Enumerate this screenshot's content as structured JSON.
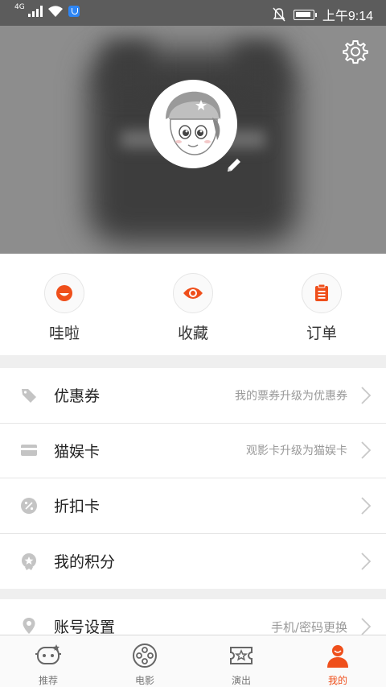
{
  "status_bar": {
    "network": "4G",
    "time": "上午9:14"
  },
  "colors": {
    "accent": "#ef4f1b",
    "header_bg": "#8d8d8d",
    "divider": "#efefef"
  },
  "header": {
    "settings_icon": "gear-icon",
    "avatar_icon": "cartoon-avatar",
    "edit_icon": "pencil-icon"
  },
  "quick_actions": [
    {
      "label": "哇啦",
      "icon": "smile-icon"
    },
    {
      "label": "收藏",
      "icon": "eye-icon"
    },
    {
      "label": "订单",
      "icon": "clipboard-icon"
    }
  ],
  "menu": {
    "coupon": {
      "label": "优惠券",
      "hint": "我的票券升级为优惠券",
      "icon": "tag-icon"
    },
    "maoyu_card": {
      "label": "猫娱卡",
      "hint": "观影卡升级为猫娱卡",
      "icon": "card-icon"
    },
    "discount_card": {
      "label": "折扣卡",
      "hint": "",
      "icon": "percent-badge-icon"
    },
    "points": {
      "label": "我的积分",
      "hint": "",
      "icon": "medal-icon"
    },
    "account": {
      "label": "账号设置",
      "hint": "手机/密码更换",
      "icon": "location-pin-icon"
    }
  },
  "tabs": [
    {
      "label": "推荐",
      "icon": "robot-face-icon",
      "active": false
    },
    {
      "label": "电影",
      "icon": "film-reel-icon",
      "active": false
    },
    {
      "label": "演出",
      "icon": "ticket-star-icon",
      "active": false
    },
    {
      "label": "我的",
      "icon": "user-icon",
      "active": true
    }
  ]
}
